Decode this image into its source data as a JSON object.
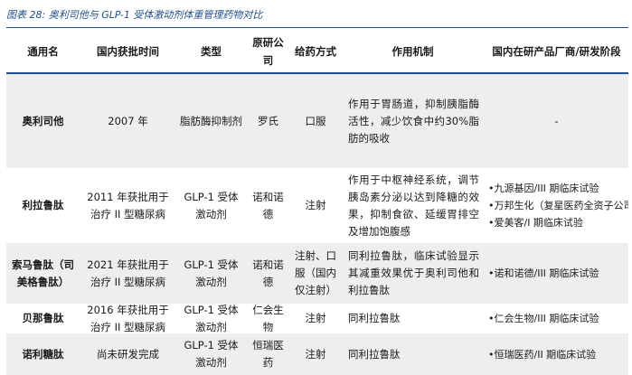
{
  "caption": "图表 28: 奥利司他与 GLP-1 受体激动剂体重管理药物对比",
  "headers": {
    "name": "通用名",
    "approval": "国内获批时间",
    "type": "类型",
    "company": "原研公司",
    "route": "给药方式",
    "mechanism": "作用机制",
    "domestic": "国内在研产品厂商/研发阶段"
  },
  "rows": [
    {
      "name": "奥利司他",
      "approval": "2007 年",
      "type": "脂肪酶抑制剂",
      "company": "罗氏",
      "route": "口服",
      "mechanism": "作用于胃肠道，抑制胰脂酶活性，减少饮食中约30%脂肪的吸收",
      "domestic": [
        "-"
      ]
    },
    {
      "name": "利拉鲁肽",
      "approval": "2011 年获批用于治疗 II 型糖尿病",
      "type": "GLP-1 受体激动剂",
      "company": "诺和诺德",
      "route": "注射",
      "mechanism": "作用于中枢神经系统，调节胰岛素分泌以达到降糖的效果，抑制食欲、延缓胃排空及增加饱腹感",
      "domestic": [
        "•九源基因/III 期临床试验",
        "•万邦生化（复星医药全资子公司）/III 期临床试验",
        "•爱美客/I 期临床试验"
      ]
    },
    {
      "name": "索马鲁肽（司美格鲁肽）",
      "approval": "2021 年获批用于治疗 II 型糖尿病",
      "type": "GLP-1 受体激动剂",
      "company": "诺和诺德",
      "route": "注射、口服（国内仅注射）",
      "mechanism": "同利拉鲁肽，临床试验显示其减重效果优于奥利司他和利拉鲁肽",
      "domestic": [
        "•诺和诺德/III 期临床试验"
      ]
    },
    {
      "name": "贝那鲁肽",
      "approval": "2016 年获批用于治疗 II 型糖尿病",
      "type": "GLP-1 受体激动剂",
      "company": "仁会生物",
      "route": "注射",
      "mechanism": "同利拉鲁肽",
      "domestic": [
        "•仁会生物/III 期临床试验"
      ]
    },
    {
      "name": "诺利糖肽",
      "approval": "尚未研发完成",
      "type": "GLP-1 受体激动剂",
      "company": "恒瑞医药",
      "route": "注射",
      "mechanism": "同利拉鲁肽",
      "domestic": [
        "•恒瑞医药/II 期临床试验"
      ]
    }
  ]
}
